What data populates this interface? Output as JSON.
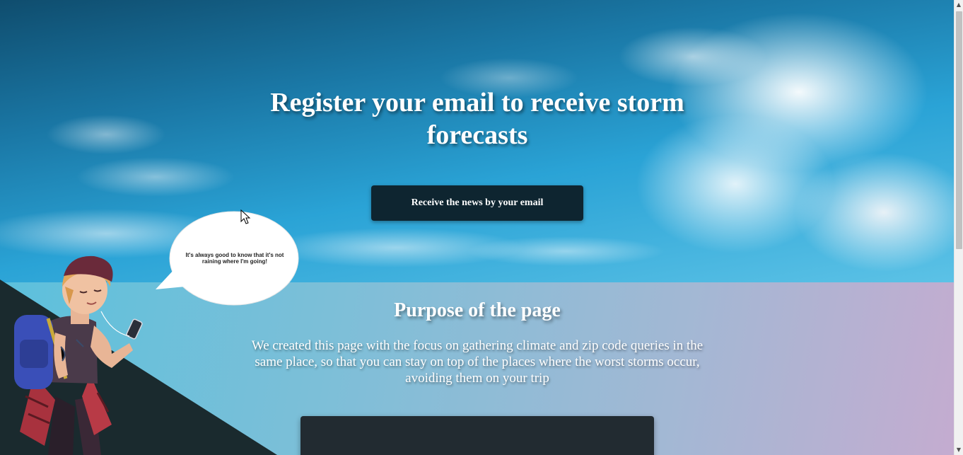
{
  "hero": {
    "title": "Register your email to receive storm forecasts",
    "cta_label": "Receive the news by your email"
  },
  "illustration": {
    "speech_bubble": "It's always good to know that it's not raining where I'm going!"
  },
  "purpose": {
    "title": "Purpose of the page",
    "description": "We created this page with the focus on gathering climate and zip code queries in the same place, so that you can stay on top of the places where the worst storms occur, avoiding them on your trip"
  },
  "scrollbar": {
    "up_icon": "chevron-up-icon",
    "down_icon": "chevron-down-icon"
  },
  "colors": {
    "button_bg": "#0e2530",
    "form_card_bg": "#222b31",
    "wedge": "#1a2a2e"
  }
}
